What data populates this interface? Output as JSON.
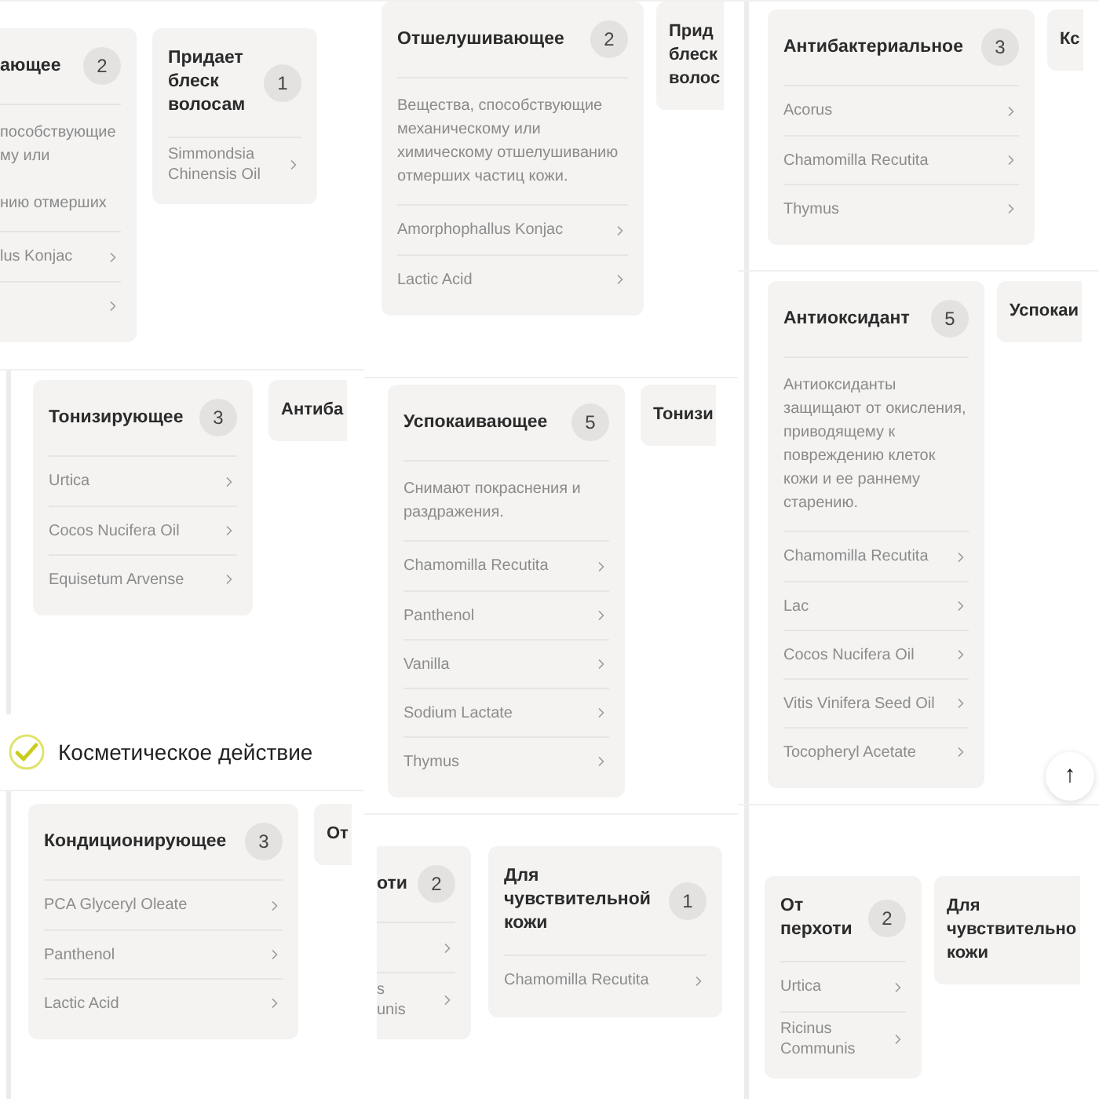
{
  "columns": [
    {
      "panels": [
        {
          "kind": "cards",
          "rail": false,
          "cards": [
            {
              "kind": "clipped",
              "title": "ающее",
              "count": "2",
              "description": "пособствующие\nму или\n\nнию отмерших\n",
              "items": [
                {
                  "kind": "link",
                  "label": "lus Konjac"
                },
                {
                  "kind": "chevron"
                }
              ]
            },
            {
              "kind": "full",
              "title": "Придает блеск волосам",
              "count": "1",
              "items": [
                {
                  "kind": "link",
                  "label": "Simmondsia Chinensis Oil"
                }
              ]
            }
          ]
        },
        {
          "kind": "cards",
          "rail": true,
          "cards": [
            {
              "kind": "full",
              "title": "Тонизирующее",
              "count": "3",
              "items": [
                {
                  "kind": "link",
                  "label": "Urtica"
                },
                {
                  "kind": "link",
                  "label": "Cocos Nucifera Oil"
                },
                {
                  "kind": "link",
                  "label": "Equisetum Arvense"
                }
              ]
            },
            {
              "kind": "stub",
              "title": "Антиба"
            }
          ]
        },
        {
          "kind": "heading",
          "text": "Косметическое действие",
          "checked": true
        },
        {
          "kind": "cards",
          "rail": true,
          "cards": [
            {
              "kind": "full",
              "title": "Кондиционирующее",
              "count": "3",
              "items": [
                {
                  "kind": "link",
                  "label": "PCA Glyceryl Oleate"
                },
                {
                  "kind": "link",
                  "label": "Panthenol"
                },
                {
                  "kind": "link",
                  "label": "Lactic Acid"
                }
              ]
            },
            {
              "kind": "stub",
              "title": "От"
            }
          ]
        }
      ]
    },
    {
      "panels": [
        {
          "kind": "cards",
          "rail": false,
          "cards": [
            {
              "kind": "full",
              "title": "Отшелушивающее",
              "count": "2",
              "description": "Вещества, способствующие механическому или химическому отшелушиванию отмерших частиц кожи.",
              "items": [
                {
                  "kind": "link",
                  "label": "Amorphophallus Konjac"
                },
                {
                  "kind": "link",
                  "label": "Lactic Acid"
                }
              ]
            },
            {
              "kind": "stub",
              "title": "Прид блеск волос"
            }
          ]
        },
        {
          "kind": "cards",
          "rail": false,
          "cards": [
            {
              "kind": "full",
              "title": "Успокаивающее",
              "count": "5",
              "description": "Снимают покраснения и раздражения.",
              "items": [
                {
                  "kind": "link",
                  "label": "Chamomilla Recutita"
                },
                {
                  "kind": "link",
                  "label": "Panthenol"
                },
                {
                  "kind": "link",
                  "label": "Vanilla"
                },
                {
                  "kind": "link",
                  "label": "Sodium Lactate"
                },
                {
                  "kind": "link",
                  "label": "Thymus"
                }
              ]
            },
            {
              "kind": "stub",
              "title": "Тонизи"
            }
          ]
        },
        {
          "kind": "cards",
          "rail": false,
          "cards": [
            {
              "kind": "clipped",
              "title": "оти",
              "count": "2",
              "items": [
                {
                  "kind": "chevron"
                },
                {
                  "kind": "link",
                  "label": "s\nunis"
                }
              ]
            },
            {
              "kind": "full",
              "title": "Для чувствительной кожи",
              "count": "1",
              "items": [
                {
                  "kind": "link",
                  "label": "Chamomilla Recutita"
                }
              ]
            }
          ]
        }
      ]
    },
    {
      "panels": [
        {
          "kind": "cards",
          "rail": true,
          "cards": [
            {
              "kind": "full",
              "title": "Антибактериальное",
              "count": "3",
              "items": [
                {
                  "kind": "link",
                  "label": "Acorus"
                },
                {
                  "kind": "link",
                  "label": "Chamomilla Recutita"
                },
                {
                  "kind": "link",
                  "label": "Thymus"
                }
              ]
            },
            {
              "kind": "stub",
              "title": "Кс"
            }
          ]
        },
        {
          "kind": "cards",
          "rail": true,
          "cards": [
            {
              "kind": "full",
              "title": "Антиоксидант",
              "count": "5",
              "description": "Антиоксиданты защищают от окисления, приводящему к повреждению клеток кожи и ее раннему старению.",
              "items": [
                {
                  "kind": "link",
                  "label": "Chamomilla Recutita"
                },
                {
                  "kind": "link",
                  "label": "Lac"
                },
                {
                  "kind": "link",
                  "label": "Cocos Nucifera Oil"
                },
                {
                  "kind": "link",
                  "label": "Vitis Vinifera Seed Oil"
                },
                {
                  "kind": "link",
                  "label": "Tocopheryl Acetate"
                }
              ]
            },
            {
              "kind": "stub",
              "title": "Успокаи"
            }
          ]
        },
        {
          "kind": "cards",
          "rail": true,
          "cards": [
            {
              "kind": "full",
              "title": "От перхоти",
              "count": "2",
              "items": [
                {
                  "kind": "link",
                  "label": "Urtica"
                },
                {
                  "kind": "link",
                  "label": "Ricinus Communis"
                }
              ]
            },
            {
              "kind": "stub",
              "title": "Для чувствительно кожи"
            }
          ]
        }
      ]
    }
  ],
  "scroll_top_button": "↑"
}
